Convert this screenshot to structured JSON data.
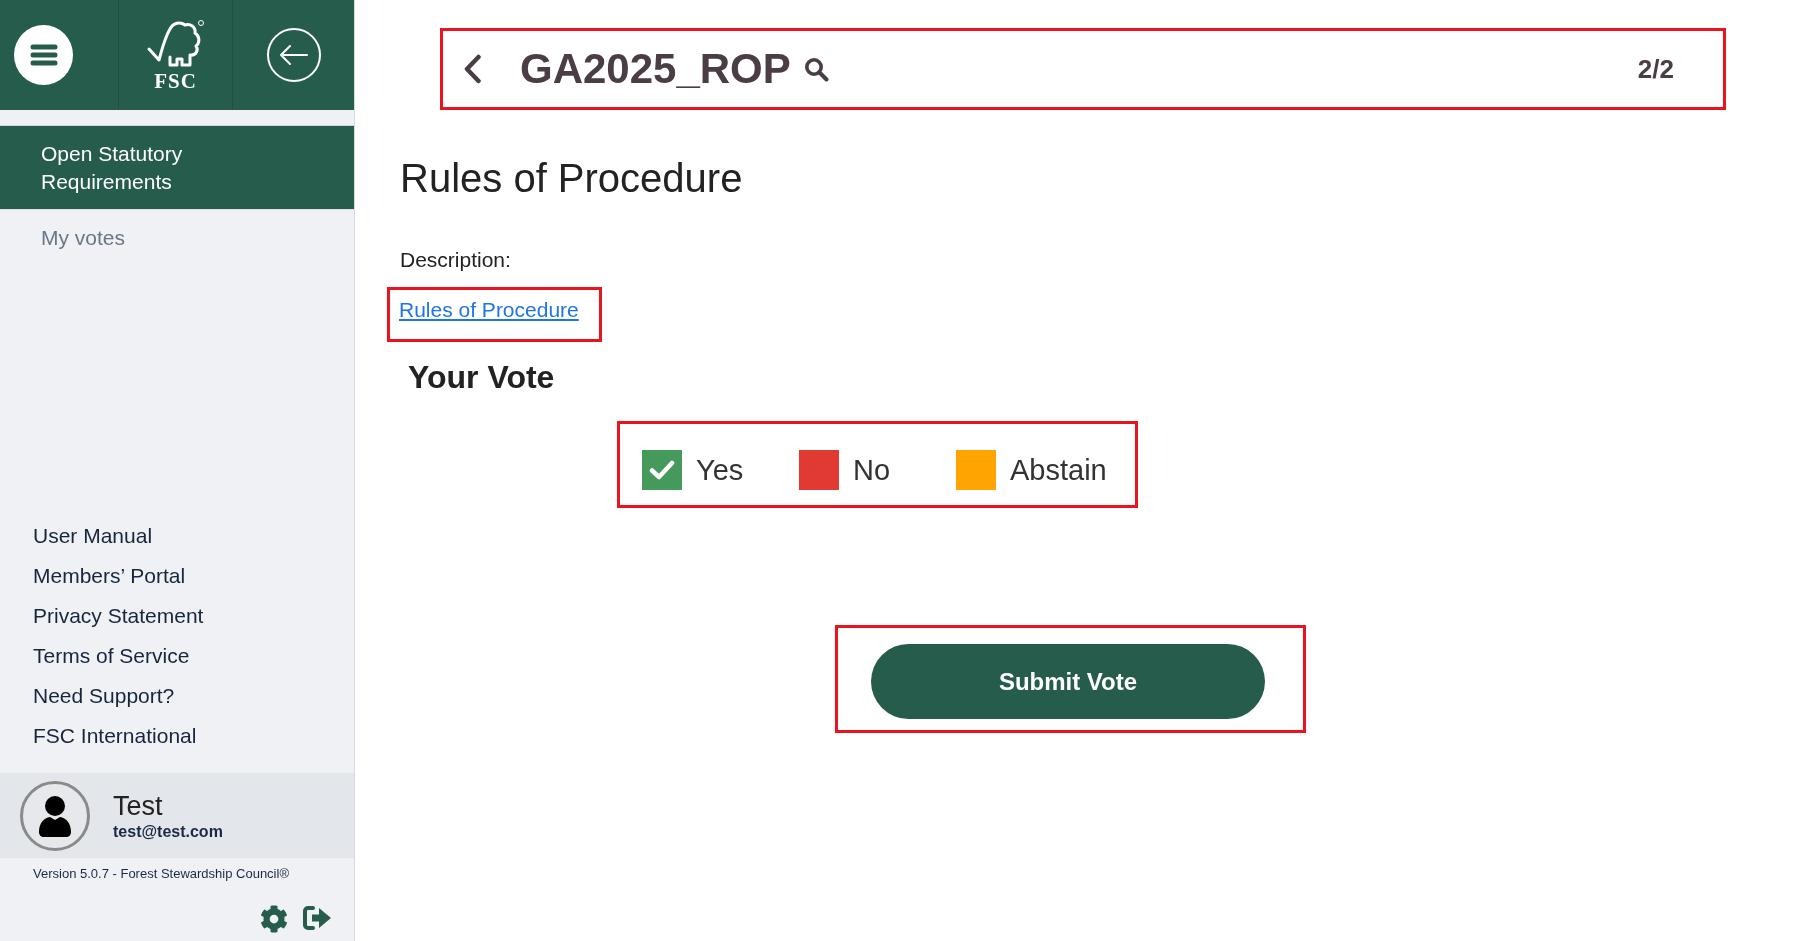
{
  "sidebar": {
    "logo_text": "FSC",
    "menu": [
      {
        "label": "Open Statutory Requirements",
        "selected": true
      },
      {
        "label": "My votes",
        "selected": false
      }
    ],
    "links": [
      "User Manual",
      "Members’ Portal",
      "Privacy Statement",
      "Terms of Service",
      "Need Support?",
      "FSC International"
    ],
    "user": {
      "name": "Test",
      "email": "test@test.com"
    },
    "version": "Version 5.0.7 - Forest Stewardship Council®"
  },
  "header": {
    "code": "GA2025_ROP",
    "position": "2/2",
    "highlighted": true
  },
  "title": "Rules of Procedure",
  "description": {
    "label": "Description:",
    "link": "Rules of Procedure",
    "link_highlighted": true
  },
  "vote": {
    "heading": "Your Vote",
    "highlighted": true,
    "options": [
      {
        "label": "Yes",
        "color": "#45995b",
        "selected": true
      },
      {
        "label": "No",
        "color": "#e13a33",
        "selected": false
      },
      {
        "label": "Abstain",
        "color": "#ffa400",
        "selected": false
      }
    ]
  },
  "submit": {
    "label": "Submit Vote",
    "highlighted": true
  }
}
